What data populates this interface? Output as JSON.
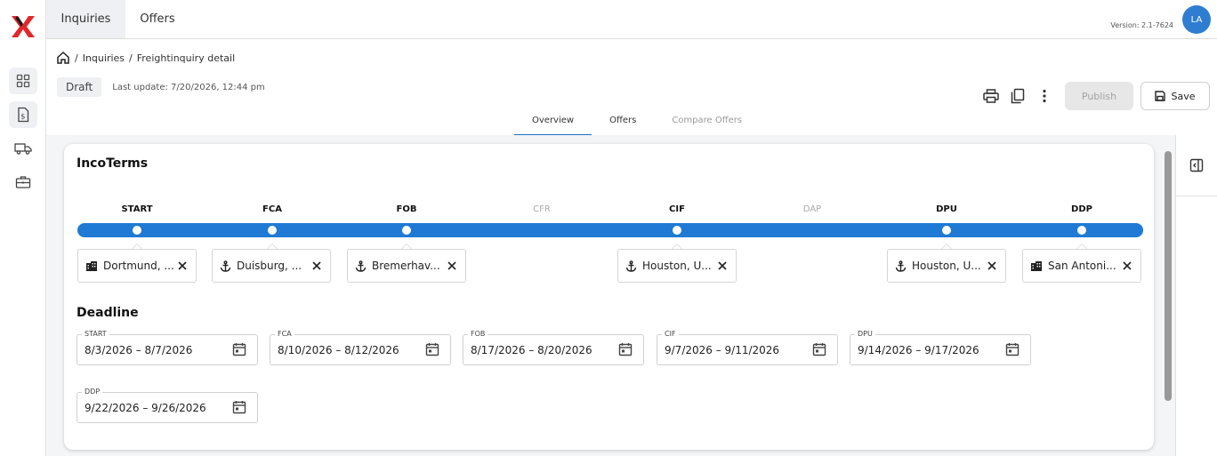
{
  "nav": {
    "top_tabs": [
      {
        "label": "Inquiries",
        "active": true
      },
      {
        "label": "Offers",
        "active": false
      }
    ],
    "version": "Version: 2.1-7624",
    "avatar_initials": "LA",
    "rail_icons": [
      "dashboard-icon",
      "invoice-icon",
      "truck-icon",
      "briefcase-icon"
    ]
  },
  "breadcrumb": {
    "items": [
      "Inquiries",
      "Freightinquiry detail"
    ]
  },
  "status": {
    "badge": "Draft",
    "last_update": "Last update: 7/20/2026, 12:44 pm"
  },
  "toolbar": {
    "publish_label": "Publish",
    "save_label": "Save"
  },
  "sub_tabs": [
    {
      "label": "Overview",
      "active": true,
      "disabled": false
    },
    {
      "label": "Offers",
      "active": false,
      "disabled": false
    },
    {
      "label": "Compare Offers",
      "active": false,
      "disabled": true
    }
  ],
  "incoterms": {
    "title": "IncoTerms",
    "stages": [
      {
        "label": "START",
        "enabled": true
      },
      {
        "label": "FCA",
        "enabled": true
      },
      {
        "label": "FOB",
        "enabled": true
      },
      {
        "label": "CFR",
        "enabled": false
      },
      {
        "label": "CIF",
        "enabled": true
      },
      {
        "label": "DAP",
        "enabled": false
      },
      {
        "label": "DPU",
        "enabled": true
      },
      {
        "label": "DDP",
        "enabled": true
      }
    ],
    "locations": [
      {
        "stage": "START",
        "text": "Dortmund, ...",
        "icon": "building-icon"
      },
      {
        "stage": "FCA",
        "text": "Duisburg, ...",
        "icon": "anchor-icon"
      },
      {
        "stage": "FOB",
        "text": "Bremerhav...",
        "icon": "anchor-icon"
      },
      {
        "stage": "CIF",
        "text": "Houston, U...",
        "icon": "anchor-icon"
      },
      {
        "stage": "DPU",
        "text": "Houston, U...",
        "icon": "anchor-icon"
      },
      {
        "stage": "DDP",
        "text": "San Antoni...",
        "icon": "building-icon"
      }
    ],
    "track_color": "#1e7ad4"
  },
  "deadline": {
    "title": "Deadline",
    "fields": [
      {
        "label": "START",
        "value": "8/3/2026  – 8/7/2026"
      },
      {
        "label": "FCA",
        "value": "8/10/2026  – 8/12/2026"
      },
      {
        "label": "FOB",
        "value": "8/17/2026  – 8/20/2026"
      },
      {
        "label": "CIF",
        "value": "9/7/2026  – 9/11/2026"
      },
      {
        "label": "DPU",
        "value": "9/14/2026  – 9/17/2026"
      },
      {
        "label": "DDP",
        "value": "9/22/2026  – 9/26/2026"
      }
    ]
  },
  "colors": {
    "accent": "#1e7ad4",
    "avatar": "#2f7dd1",
    "logo_red": "#e3262b"
  }
}
